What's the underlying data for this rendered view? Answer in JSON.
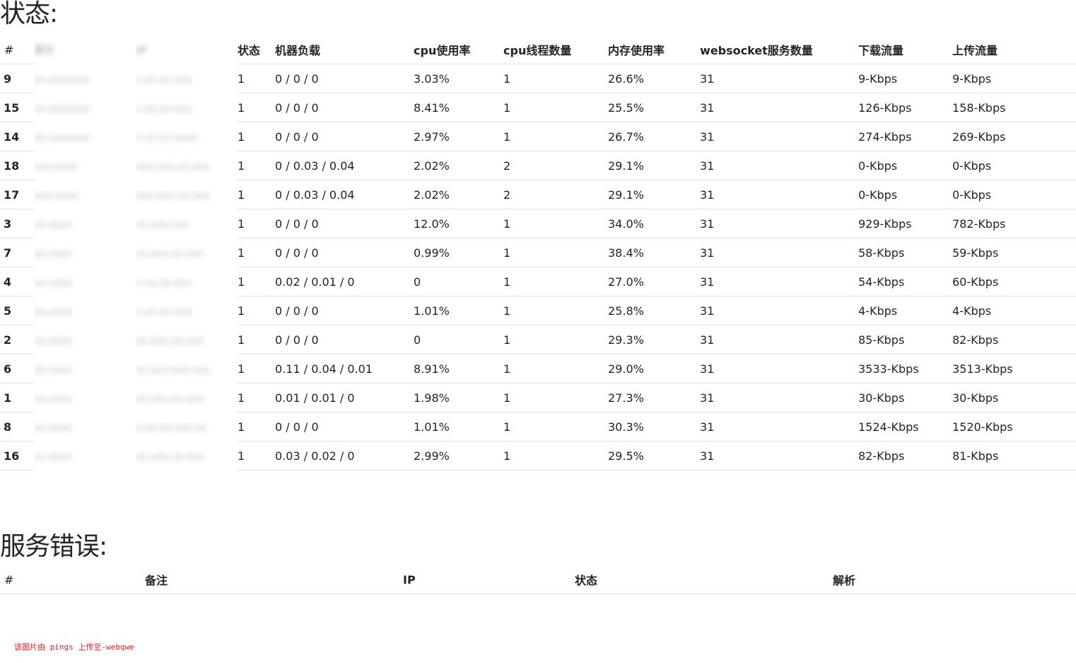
{
  "status_section": {
    "title": "状态:",
    "headers": {
      "hash": "#",
      "col2": "备注",
      "col3": "IP",
      "state": "状态",
      "load": "机器负载",
      "cpu": "cpu使用率",
      "threads": "cpu线程数量",
      "mem": "内存使用率",
      "ws": "websocket服务数量",
      "down": "下载流量",
      "up": "上传流量"
    },
    "rows": [
      {
        "id": "9",
        "note": "xx.xxxxxxx",
        "ip": "x.xx.xx.xxx",
        "state": "1",
        "load": "0 / 0 / 0",
        "cpu": "3.03%",
        "threads": "1",
        "mem": "26.6%",
        "ws": "31",
        "down": "9-Kbps",
        "up": "9-Kbps"
      },
      {
        "id": "15",
        "note": "xx.xxxxxxx",
        "ip": "x.xx.xx.xxx",
        "state": "1",
        "load": "0 / 0 / 0",
        "cpu": "8.41%",
        "threads": "1",
        "mem": "25.5%",
        "ws": "31",
        "down": "126-Kbps",
        "up": "158-Kbps"
      },
      {
        "id": "14",
        "note": "xx.xxxxxxx",
        "ip": "x.xx.xx.xxxx",
        "state": "1",
        "load": "0 / 0 / 0",
        "cpu": "2.97%",
        "threads": "1",
        "mem": "26.7%",
        "ws": "31",
        "down": "274-Kbps",
        "up": "269-Kbps"
      },
      {
        "id": "18",
        "note": "xxx.xxxx",
        "ip": "xxx.xxx.xx.xxx",
        "state": "1",
        "load": "0 / 0.03 / 0.04",
        "cpu": "2.02%",
        "threads": "2",
        "mem": "29.1%",
        "ws": "31",
        "down": "0-Kbps",
        "up": "0-Kbps"
      },
      {
        "id": "17",
        "note": "xxx.xxxx",
        "ip": "xxx.xxx.xx.xxx",
        "state": "1",
        "load": "0 / 0.03 / 0.04",
        "cpu": "2.02%",
        "threads": "2",
        "mem": "29.1%",
        "ws": "31",
        "down": "0-Kbps",
        "up": "0-Kbps"
      },
      {
        "id": "3",
        "note": "xx.xxxx",
        "ip": "xx.xxx.xxx",
        "state": "1",
        "load": "0 / 0 / 0",
        "cpu": "12.0%",
        "threads": "1",
        "mem": "34.0%",
        "ws": "31",
        "down": "929-Kbps",
        "up": "782-Kbps"
      },
      {
        "id": "7",
        "note": "xx.xxxx",
        "ip": "xx.xxx.xx.xxx",
        "state": "1",
        "load": "0 / 0 / 0",
        "cpu": "0.99%",
        "threads": "1",
        "mem": "38.4%",
        "ws": "31",
        "down": "58-Kbps",
        "up": "59-Kbps"
      },
      {
        "id": "4",
        "note": "xx.xxxx",
        "ip": "x.xx.xx.xxx",
        "state": "1",
        "load": "0.02 / 0.01 / 0",
        "cpu": "0",
        "threads": "1",
        "mem": "27.0%",
        "ws": "31",
        "down": "54-Kbps",
        "up": "60-Kbps"
      },
      {
        "id": "5",
        "note": "xx.xxxx",
        "ip": "x.xx.xx.xxx",
        "state": "1",
        "load": "0 / 0 / 0",
        "cpu": "1.01%",
        "threads": "1",
        "mem": "25.8%",
        "ws": "31",
        "down": "4-Kbps",
        "up": "4-Kbps"
      },
      {
        "id": "2",
        "note": "xx.xxxx",
        "ip": "xx.xxx.xx.xxx",
        "state": "1",
        "load": "0 / 0 / 0",
        "cpu": "0",
        "threads": "1",
        "mem": "29.3%",
        "ws": "31",
        "down": "85-Kbps",
        "up": "82-Kbps"
      },
      {
        "id": "6",
        "note": "xx.xxxx",
        "ip": "xx.xxx.xxx.xxx",
        "state": "1",
        "load": "0.11 / 0.04 / 0.01",
        "cpu": "8.91%",
        "threads": "1",
        "mem": "29.0%",
        "ws": "31",
        "down": "3533-Kbps",
        "up": "3513-Kbps"
      },
      {
        "id": "1",
        "note": "xx.xxxx",
        "ip": "xx.xxx.xx.xxx",
        "state": "1",
        "load": "0.01 / 0.01 / 0",
        "cpu": "1.98%",
        "threads": "1",
        "mem": "27.3%",
        "ws": "31",
        "down": "30-Kbps",
        "up": "30-Kbps"
      },
      {
        "id": "8",
        "note": "xx.xxxx",
        "ip": "x.xx.xx.xxx.xx",
        "state": "1",
        "load": "0 / 0 / 0",
        "cpu": "1.01%",
        "threads": "1",
        "mem": "30.3%",
        "ws": "31",
        "down": "1524-Kbps",
        "up": "1520-Kbps"
      },
      {
        "id": "16",
        "note": "xx.xxxx",
        "ip": "xx.xxx.xx.xxx",
        "state": "1",
        "load": "0.03 / 0.02 / 0",
        "cpu": "2.99%",
        "threads": "1",
        "mem": "29.5%",
        "ws": "31",
        "down": "82-Kbps",
        "up": "81-Kbps"
      }
    ]
  },
  "errors_section": {
    "title": "服务错误:",
    "headers": {
      "hash": "#",
      "note": "备注",
      "ip": "IP",
      "state": "状态",
      "resolve": "解析"
    }
  },
  "watermark": "该图片由 pings 上传至-webqwe",
  "colors": {
    "text": "#212529",
    "border": "#dee2e6",
    "watermark": "#e02020"
  }
}
